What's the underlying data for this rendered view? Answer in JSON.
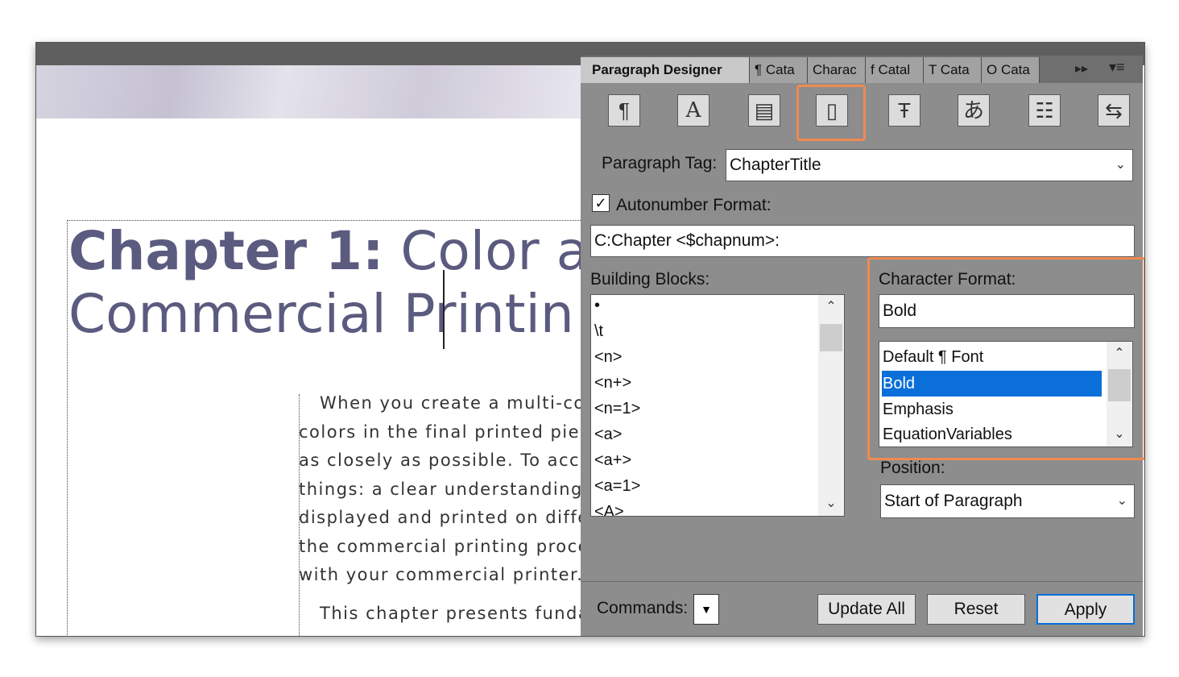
{
  "document": {
    "title_bold": "Chapter 1:",
    "title_rest_line1": "Color a",
    "title_line2": "Commercial Printin",
    "paragraphs": [
      [
        "When you create a multi-colo",
        "colors in the final printed piece",
        "as closely as possible. To accon",
        "things: a clear understanding c",
        "displayed and printed on differ",
        "the commercial printing proces",
        "with your commercial printer."
      ],
      [
        "This chapter presents fundar"
      ]
    ]
  },
  "panel": {
    "tabs": [
      {
        "label": "Paragraph Designer"
      },
      {
        "label": "¶ Cata"
      },
      {
        "label": "Charac"
      },
      {
        "label": "f Catal"
      },
      {
        "label": "T Cata"
      },
      {
        "label": "O Cata"
      }
    ],
    "overflow_glyph": "▸▸",
    "menu_glyph": "▾≡",
    "toolbar": [
      {
        "icon": "paragraph-mark-icon",
        "glyph": "¶"
      },
      {
        "icon": "character-icon",
        "glyph": "A"
      },
      {
        "icon": "pagination-icon",
        "glyph": "▤"
      },
      {
        "icon": "numbering-icon",
        "glyph": "▯"
      },
      {
        "icon": "advanced-icon",
        "glyph": "Ŧ"
      },
      {
        "icon": "asian-icon",
        "glyph": "あ"
      },
      {
        "icon": "table-cell-icon",
        "glyph": "☷"
      },
      {
        "icon": "direction-icon",
        "glyph": "⇆"
      }
    ],
    "paragraph_tag_label": "Paragraph Tag:",
    "paragraph_tag_value": "ChapterTitle",
    "autonumber_label": "Autonumber Format:",
    "autonumber_checked": true,
    "autonumber_value": "C:Chapter <$chapnum>:",
    "building_blocks_label": "Building Blocks:",
    "building_blocks": [
      "•",
      "\\t",
      "<n>",
      "<n+>",
      "<n=1>",
      "<a>",
      "<a+>",
      "<a=1>",
      "<A>"
    ],
    "character_format_label": "Character Format:",
    "character_format_value": "Bold",
    "character_formats": [
      "Default ¶ Font",
      "Bold",
      "Emphasis",
      "EquationVariables"
    ],
    "character_format_selected": "Bold",
    "position_label": "Position:",
    "position_value": "Start of Paragraph",
    "commands_label": "Commands:",
    "buttons": {
      "update_all": "Update All",
      "reset": "Reset",
      "apply": "Apply"
    },
    "highlight_color": "#ef8a52",
    "selection_color": "#0a6fd8"
  }
}
